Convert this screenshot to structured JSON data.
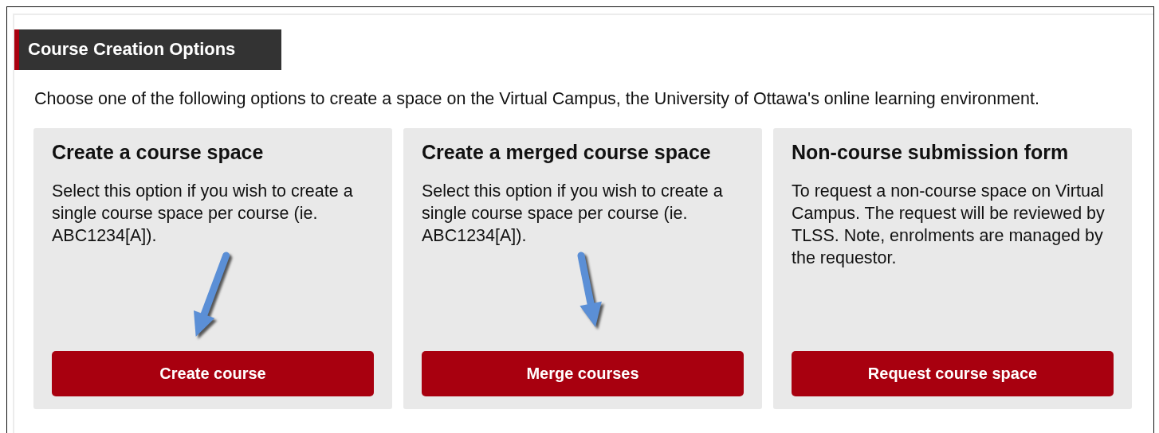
{
  "section": {
    "title": "Course Creation Options"
  },
  "intro": "Choose one of the following options to create a space on the Virtual Campus, the University of Ottawa's online learning environment.",
  "cards": [
    {
      "title": "Create a course space",
      "description": "Select this option if you wish to create a single course space per course (ie. ABC1234[A]).",
      "button": "Create course",
      "arrow": true
    },
    {
      "title": "Create a merged course space",
      "description": "Select this option if you wish to create a single course space per course (ie. ABC1234[A]).",
      "button": "Merge courses",
      "arrow": true
    },
    {
      "title": "Non-course submission form",
      "description": "To request a non-course space on Virtual Campus. The request will be reviewed by TLSS. Note, enrolments are managed by the requestor.",
      "button": "Request course space",
      "arrow": false
    }
  ]
}
